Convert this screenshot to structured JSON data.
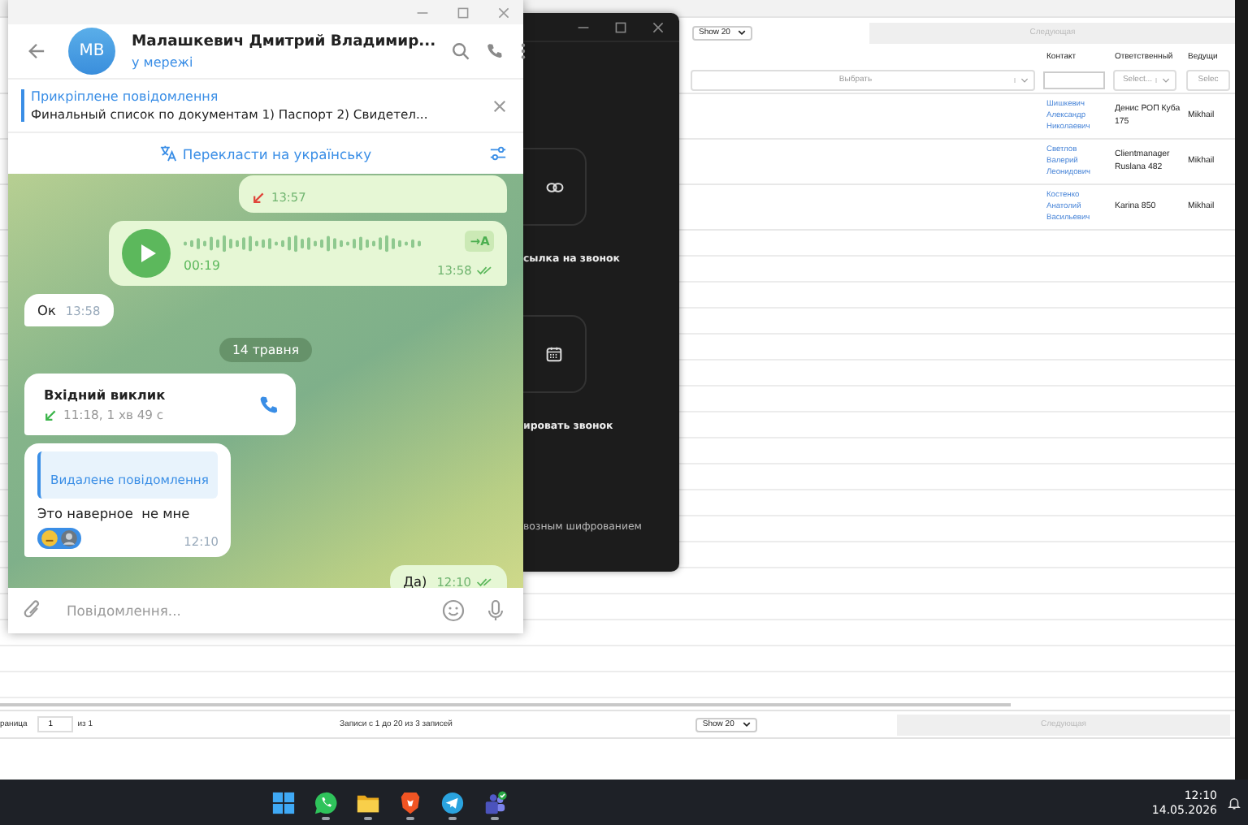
{
  "web_page": {
    "page_size": "Show 20",
    "next": {
      "label": "Следующая",
      "disabled": true
    },
    "columns": [
      "Контакт",
      "Ответственный",
      "Ведущи"
    ],
    "filters": [
      {
        "kind": "select",
        "text": "Выбрать"
      },
      {
        "kind": "input"
      },
      {
        "kind": "select",
        "text": "Select..."
      },
      {
        "kind": "select",
        "text": "Selec"
      }
    ],
    "rows": [
      {
        "contact": "Шишкевич Александр Николаевич",
        "responsible": "Денис РОП Куба 175",
        "lead": "Mikhail"
      },
      {
        "contact": "Светлов Валерий Леонидович",
        "responsible": "Clientmanager Ruslana 482",
        "lead": "Mikhail"
      },
      {
        "contact": "Костенко Анатолий Васильевич",
        "responsible": "Karina 850",
        "lead": "Mikhail"
      }
    ],
    "footer": {
      "page_label": "раница",
      "page": "1",
      "of": "из 1",
      "records": "Записи с 1 до 20 из 3 записей",
      "page_size": "Show 20",
      "next": {
        "label": "Следующая",
        "disabled": true
      }
    }
  },
  "call_window": {
    "items": [
      {
        "kind": "link",
        "label": "сылка на звонок"
      },
      {
        "kind": "calendar",
        "label": "ировать звонок"
      }
    ],
    "note": "возным шифрованием"
  },
  "telegram": {
    "avatar": "МВ",
    "name": "Малашкевич Дмитрий Владимир...",
    "status": "у мережі",
    "pinned": {
      "label": "Прикріплене повідомлення",
      "text": "Финальный список по документам  1) Паспорт 2) Свидетел..."
    },
    "translate": "Перекласти на українську",
    "messages": [
      {
        "kind": "call",
        "outgoing": true,
        "missed": true,
        "time": "13:57"
      },
      {
        "kind": "voice",
        "outgoing": true,
        "duration": "00:19",
        "transcribe": "→A",
        "time": "13:58",
        "read": true
      },
      {
        "kind": "text",
        "outgoing": false,
        "text": "Ок",
        "time": "13:58"
      },
      {
        "kind": "date",
        "text": "14 травня"
      },
      {
        "kind": "call",
        "outgoing": false,
        "missed": false,
        "title": "Вхідний виклик",
        "detail": "11:18, 1 хв 49 с"
      },
      {
        "kind": "text",
        "outgoing": false,
        "reply": "Видалене повідомлення",
        "text": "Это наверное  не мне",
        "reactions": [
          {
            "kind": "emoji"
          },
          {
            "kind": "avatar"
          }
        ],
        "time": "12:10"
      },
      {
        "kind": "text",
        "outgoing": true,
        "text": "Да)",
        "time": "12:10",
        "read": true
      }
    ],
    "input_placeholder": "Повідомлення..."
  },
  "taskbar": {
    "apps": [
      {
        "kind": "start",
        "running": false
      },
      {
        "kind": "whatsapp",
        "running": true
      },
      {
        "kind": "files",
        "running": true
      },
      {
        "kind": "brave",
        "running": true
      },
      {
        "kind": "telegram",
        "running": true
      },
      {
        "kind": "teams",
        "running": true
      }
    ],
    "time": "12:10",
    "date": "14.05.2026"
  }
}
